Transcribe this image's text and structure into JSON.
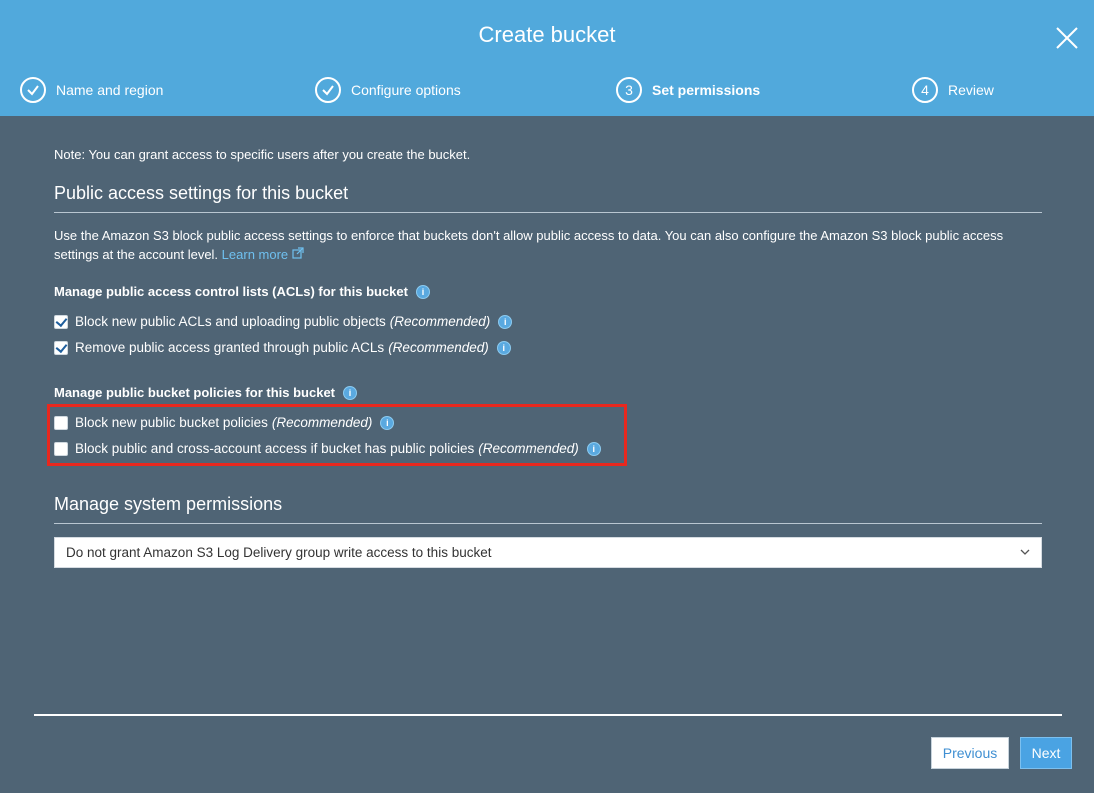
{
  "header": {
    "title": "Create bucket",
    "steps": [
      {
        "number": "",
        "label": "Name and region",
        "state": "completed"
      },
      {
        "number": "",
        "label": "Configure options",
        "state": "completed"
      },
      {
        "number": "3",
        "label": "Set permissions",
        "state": "active"
      },
      {
        "number": "4",
        "label": "Review",
        "state": "pending"
      }
    ]
  },
  "main": {
    "note": "Note: You can grant access to specific users after you create the bucket.",
    "public_access": {
      "title": "Public access settings for this bucket",
      "description": "Use the Amazon S3 block public access settings to enforce that buckets don't allow public access to data. You can also configure the Amazon S3 block public access settings at the account level.",
      "learn_more": "Learn more",
      "acl_heading": "Manage public access control lists (ACLs) for this bucket",
      "acl_options": [
        {
          "label": "Block new public ACLs and uploading public objects",
          "suffix": "(Recommended)",
          "checked": true
        },
        {
          "label": "Remove public access granted through public ACLs",
          "suffix": "(Recommended)",
          "checked": true
        }
      ],
      "policy_heading": "Manage public bucket policies for this bucket",
      "policy_options": [
        {
          "label": "Block new public bucket policies",
          "suffix": "(Recommended)",
          "checked": false
        },
        {
          "label": "Block public and cross-account access if bucket has public policies",
          "suffix": "(Recommended)",
          "checked": false
        }
      ]
    },
    "system_permissions": {
      "title": "Manage system permissions",
      "selected": "Do not grant Amazon S3 Log Delivery group write access to this bucket"
    }
  },
  "footer": {
    "previous_label": "Previous",
    "next_label": "Next"
  },
  "colors": {
    "header_bg": "#51a9dc",
    "body_bg": "#4f6475",
    "highlight": "#e8281e",
    "link": "#6fc0f0"
  }
}
